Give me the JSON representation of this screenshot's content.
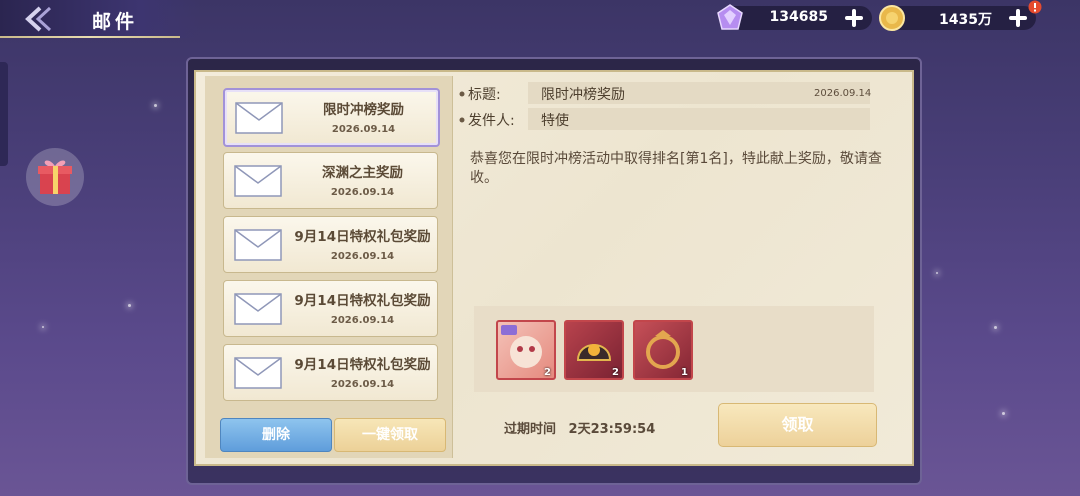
{
  "header": {
    "title": "邮件"
  },
  "resources": [
    {
      "name": "gem",
      "value": "134685",
      "icon": "gem-icon"
    },
    {
      "name": "gold",
      "value": "1435万",
      "icon": "gold-coin-icon"
    }
  ],
  "mail_list": [
    {
      "title": "限时冲榜奖励",
      "date": "2026.09.14",
      "selected": true
    },
    {
      "title": "深渊之主奖励",
      "date": "2026.09.14",
      "selected": false
    },
    {
      "title": "9月14日特权礼包奖励",
      "date": "2026.09.14",
      "selected": false
    },
    {
      "title": "9月14日特权礼包奖励",
      "date": "2026.09.14",
      "selected": false
    },
    {
      "title": "9月14日特权礼包奖励",
      "date": "2026.09.14",
      "selected": false
    }
  ],
  "actions": {
    "delete_label": "删除",
    "claim_all_label": "一键领取"
  },
  "detail": {
    "title_label": "标题:",
    "title_value": "限时冲榜奖励",
    "date": "2026.09.14",
    "sender_label": "发件人:",
    "sender_value": "特使",
    "body": "恭喜您在限时冲榜活动中取得排名[第1名]，特此献上奖励，敬请查收。",
    "rewards": [
      {
        "icon": "pet-card-icon",
        "count": "2"
      },
      {
        "icon": "helmet-icon",
        "count": "2"
      },
      {
        "icon": "ring-icon",
        "count": "1"
      }
    ],
    "expire_label": "过期时间",
    "expire_value": "2天23:59:54",
    "claim_label": "领取"
  },
  "colors": {
    "accent_purple": "#a292d8",
    "delete_blue": "#6ea9e2",
    "gold_button": "#efd7a3",
    "background": "#4a3f79"
  }
}
